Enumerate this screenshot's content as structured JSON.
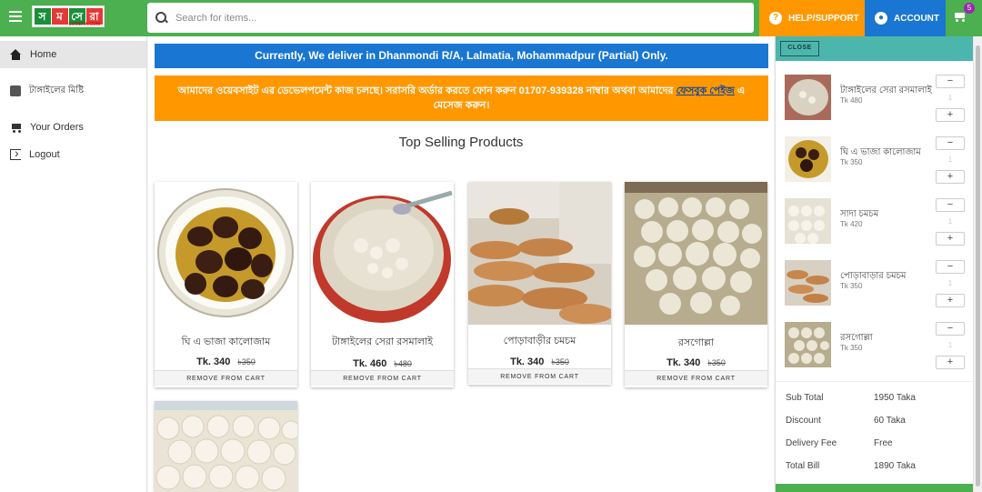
{
  "header": {
    "logo_text": [
      "স",
      "ম",
      "সে",
      "রা"
    ],
    "logo_sub": "SOMERA.COM",
    "search_placeholder": "Search for items...",
    "help_label": "HELP/SUPPORT",
    "account_label": "ACCOUNT",
    "cart_count": "5",
    "colors": {
      "bar": "#4caf50",
      "help": "#ff9800",
      "account": "#1976d2",
      "badge": "#9c27b0"
    }
  },
  "sidebar": {
    "items": [
      {
        "label": "Home",
        "icon": "home-icon",
        "active": true
      },
      {
        "label": "টাঙ্গাইলের মিষ্টি",
        "icon": "square-icon"
      },
      {
        "label": "Your Orders",
        "icon": "cart-icon"
      },
      {
        "label": "Logout",
        "icon": "logout-icon"
      }
    ]
  },
  "main": {
    "notice_delivery": "Currently, We deliver in Dhanmondi R/A, Lalmatia, Mohammadpur (Partial) Only.",
    "notice_dev_before": "আমাদের ওয়েবসাইট এর ডেভেলপমেন্ট কাজ চলছে। সরাসরি অর্ডার করতে ফোন করুন 01707-939328 নাম্বার অথবা আমাদের ",
    "notice_dev_link": "ফেসবুক পেইজ",
    "notice_dev_after": " এ মেসেজ করুন।",
    "section_title": "Top Selling Products",
    "remove_label": "REMOVE FROM CART",
    "products": [
      {
        "name": "ঘি এ ভাজা কালোজাম",
        "price": "Tk. 340",
        "old_price": "৳350"
      },
      {
        "name": "টাঙ্গাইলের সেরা রসমালাই",
        "price": "Tk. 460",
        "old_price": "৳480"
      },
      {
        "name": "পোড়াবাড়ীর চমচম",
        "price": "Tk. 340",
        "old_price": "৳350"
      },
      {
        "name": "রসগোল্লা",
        "price": "Tk. 340",
        "old_price": "৳350"
      }
    ]
  },
  "cart": {
    "close_label": "CLOSE",
    "items": [
      {
        "name": "টাঙ্গাইলের সেরা রসমালাই",
        "price": "Tk 480",
        "qty": "1"
      },
      {
        "name": "ঘি এ ভাজা কালোজাম",
        "price": "Tk 350",
        "qty": "1"
      },
      {
        "name": "সাদা চমচম",
        "price": "Tk 420",
        "qty": "1"
      },
      {
        "name": "পোড়াবাড়ার চমচম",
        "price": "Tk 350",
        "qty": "1"
      },
      {
        "name": "রসগোল্লা",
        "price": "Tk 350",
        "qty": "1"
      }
    ],
    "minus": "−",
    "plus": "+",
    "totals": [
      {
        "label": "Sub Total",
        "value": "1950 Taka"
      },
      {
        "label": "Discount",
        "value": "60 Taka"
      },
      {
        "label": "Delivery Fee",
        "value": "Free"
      },
      {
        "label": "Total Bill",
        "value": "1890 Taka"
      }
    ]
  }
}
